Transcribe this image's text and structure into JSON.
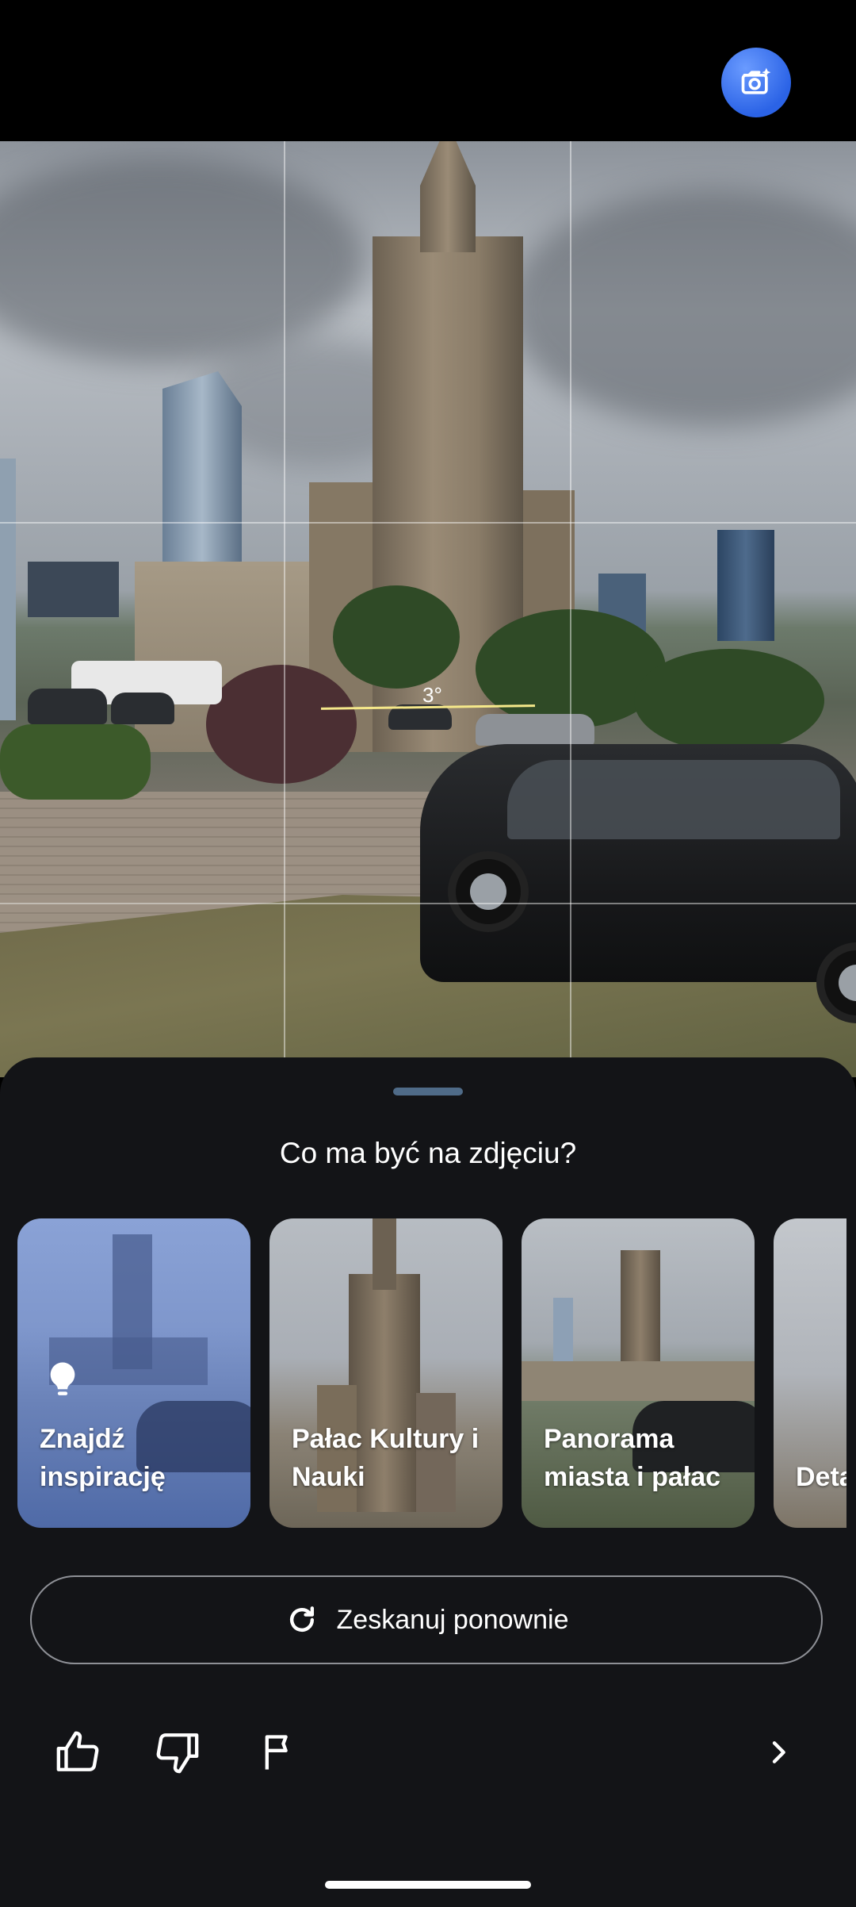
{
  "camera": {
    "level_indicator": "3°"
  },
  "sheet": {
    "question": "Co ma być na zdjęciu?",
    "suggestions": [
      {
        "label": "Znajdź inspirację",
        "icon": "lightbulb-icon"
      },
      {
        "label": "Pałac Kultury i Nauki"
      },
      {
        "label": "Panorama miasta i pałac"
      },
      {
        "label": "Detal ekto pała"
      }
    ],
    "rescan_label": "Zeskanuj ponownie"
  },
  "colors": {
    "accent_blue": "#2b63e6",
    "sheet_bg": "#131417",
    "level_line": "#f5e88a"
  }
}
